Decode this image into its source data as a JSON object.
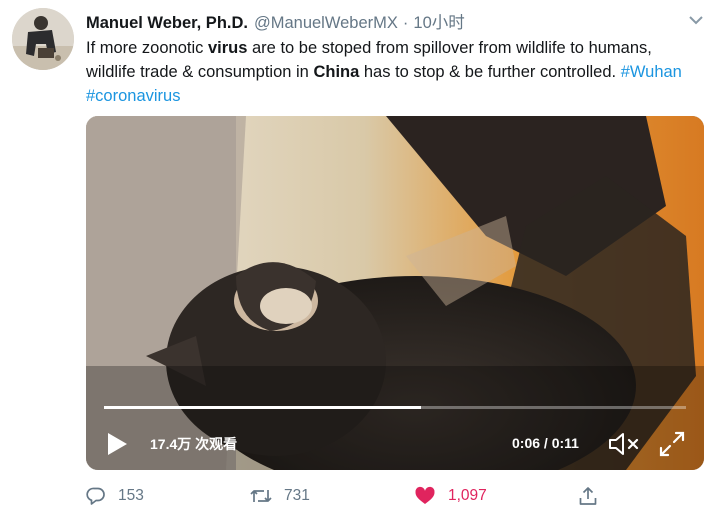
{
  "tweet": {
    "author_name": "Manuel Weber, Ph.D.",
    "handle": "@ManuelWeberMX",
    "separator": "·",
    "time": "10小时",
    "text_parts": {
      "p1": "If more zoonotic ",
      "p2": "virus",
      "p3": " are to be stoped from spillover from wildlife to humans, wildlife trade & consumption in ",
      "p4": "China",
      "p5": " has to stop & be further controlled. ",
      "tag1": "#Wuhan",
      "gap": " ",
      "tag2": "#coronavirus"
    }
  },
  "video": {
    "views": "17.4万 次观看",
    "timecode": "0:06 / 0:11",
    "progress": 0.545
  },
  "actions": {
    "reply_count": "153",
    "retweet_count": "731",
    "like_count": "1,097"
  },
  "icons": {
    "caret": "chevron-down-icon",
    "play": "play-icon",
    "mute": "volume-muted-icon",
    "fullscreen": "fullscreen-icon",
    "reply": "reply-icon",
    "retweet": "retweet-icon",
    "like": "heart-icon",
    "share": "share-icon"
  },
  "colors": {
    "text": "#14171a",
    "muted": "#657786",
    "link": "#1b95e0",
    "like": "#e0245e"
  }
}
